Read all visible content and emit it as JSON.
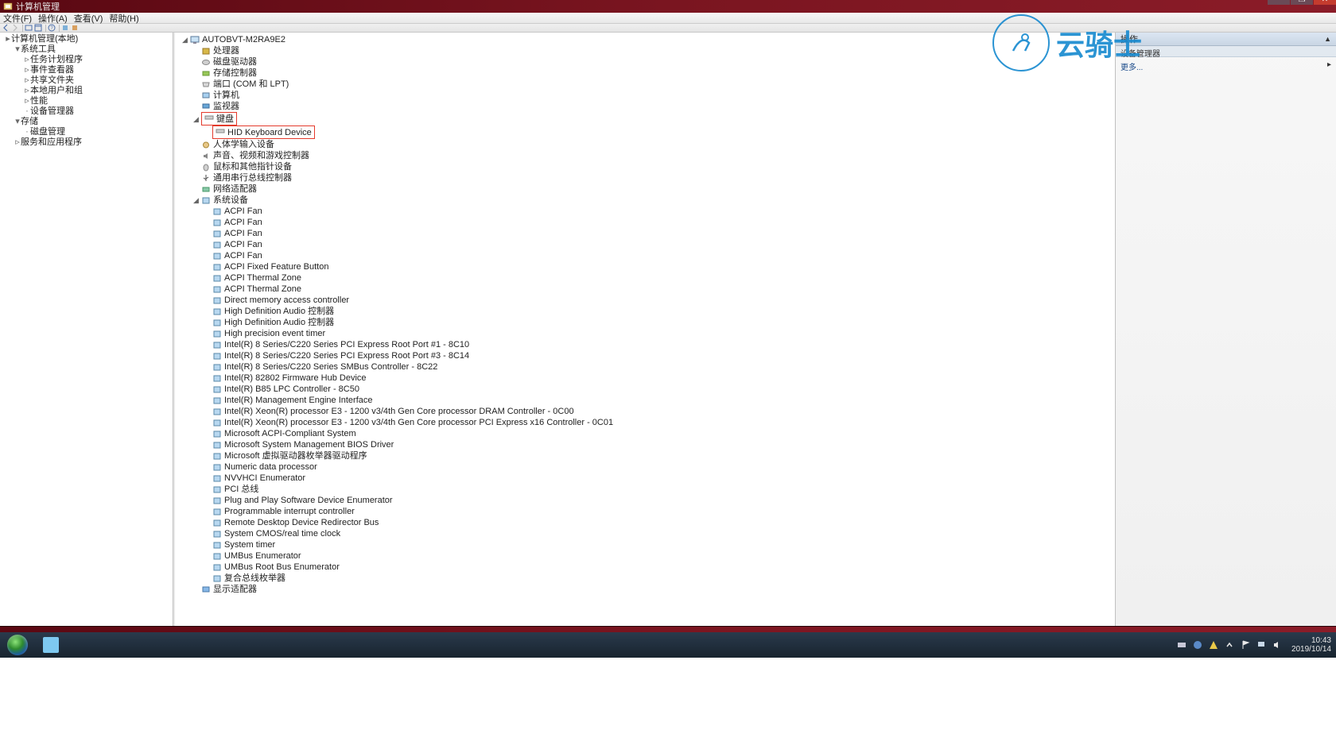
{
  "window": {
    "title": "计算机管理"
  },
  "menu": {
    "file": "文件(F)",
    "action": "操作(A)",
    "view": "查看(V)",
    "help": "帮助(H)"
  },
  "left": {
    "root": "计算机管理(本地)",
    "system_tools": "系统工具",
    "task_scheduler": "任务计划程序",
    "event_viewer": "事件查看器",
    "shared_folders": "共享文件夹",
    "local_users": "本地用户和组",
    "performance": "性能",
    "device_manager": "设备管理器",
    "storage": "存储",
    "disk_mgmt": "磁盘管理",
    "services": "服务和应用程序"
  },
  "tree": {
    "root": "AUTOBVT-M2RA9E2",
    "processors": "处理器",
    "disk_drives": "磁盘驱动器",
    "storage_ctrl": "存储控制器",
    "ports": "端口 (COM 和 LPT)",
    "computer": "计算机",
    "monitors": "监视器",
    "keyboards": "键盘",
    "hid_kb": "HID Keyboard Device",
    "hid_devices": "人体学输入设备",
    "sound": "声音、视频和游戏控制器",
    "mouse": "鼠标和其他指针设备",
    "usb": "通用串行总线控制器",
    "network": "网络适配器",
    "system_devices": "系统设备",
    "display": "显示适配器",
    "sysdev": [
      "ACPI Fan",
      "ACPI Fan",
      "ACPI Fan",
      "ACPI Fan",
      "ACPI Fan",
      "ACPI Fixed Feature Button",
      "ACPI Thermal Zone",
      "ACPI Thermal Zone",
      "Direct memory access controller",
      "High Definition Audio 控制器",
      "High Definition Audio 控制器",
      "High precision event timer",
      "Intel(R) 8 Series/C220 Series PCI Express Root Port #1 - 8C10",
      "Intel(R) 8 Series/C220 Series PCI Express Root Port #3 - 8C14",
      "Intel(R) 8 Series/C220 Series SMBus Controller - 8C22",
      "Intel(R) 82802 Firmware Hub Device",
      "Intel(R) B85 LPC Controller - 8C50",
      "Intel(R) Management Engine Interface",
      "Intel(R) Xeon(R) processor E3 - 1200 v3/4th Gen Core processor DRAM Controller - 0C00",
      "Intel(R) Xeon(R) processor E3 - 1200 v3/4th Gen Core processor PCI Express x16 Controller - 0C01",
      "Microsoft ACPI-Compliant System",
      "Microsoft System Management BIOS Driver",
      "Microsoft 虚拟驱动器枚举器驱动程序",
      "Numeric data processor",
      "NVVHCI Enumerator",
      "PCI 总线",
      "Plug and Play Software Device Enumerator",
      "Programmable interrupt controller",
      "Remote Desktop Device Redirector Bus",
      "System CMOS/real time clock",
      "System timer",
      "UMBus Enumerator",
      "UMBus Root Bus Enumerator",
      "复合总线枚举器"
    ]
  },
  "right": {
    "title": "操作",
    "sub": "设备管理器",
    "more": "更多..."
  },
  "watermark": "云骑士",
  "taskbar": {
    "time": "10:43",
    "date": "2019/10/14"
  }
}
